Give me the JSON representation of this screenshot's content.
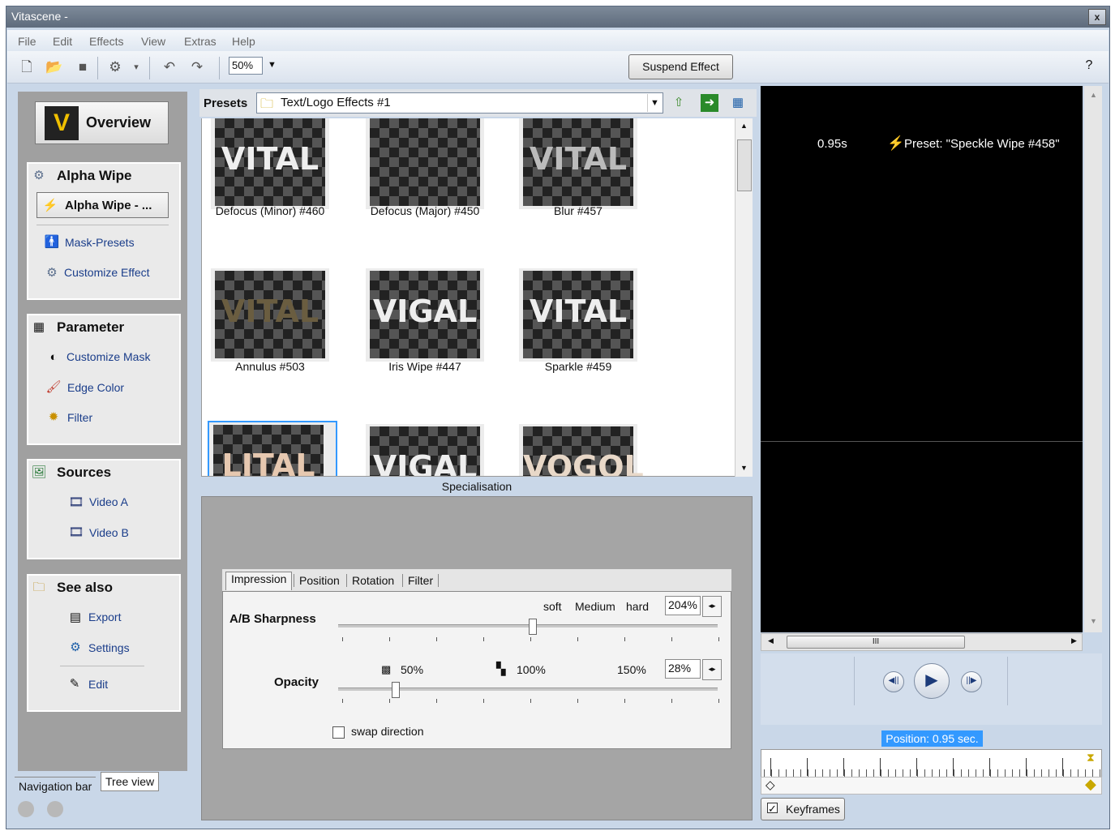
{
  "window": {
    "title": "Vitascene -",
    "close_label": "x"
  },
  "menu": [
    "File",
    "Edit",
    "Effects",
    "View",
    "Extras",
    "Help"
  ],
  "toolbar": {
    "zoom_value": "50%",
    "suspend_label": "Suspend Effect"
  },
  "nav": {
    "overview_label": "Overview",
    "overview_logo": "V",
    "alpha_section": "Alpha Wipe",
    "alpha_current": "Alpha Wipe - ...",
    "mask_presets": "Mask-Presets",
    "customize_effect": "Customize Effect",
    "parameter_section": "Parameter",
    "customize_mask": "Customize Mask",
    "edge_color": "Edge Color",
    "filter": "Filter",
    "sources_section": "Sources",
    "video_a": "Video A",
    "video_b": "Video B",
    "see_also_section": "See also",
    "export": "Export",
    "settings": "Settings",
    "edit": "Edit",
    "tab_navigation": "Navigation bar",
    "tab_tree": "Tree view"
  },
  "presets": {
    "label": "Presets",
    "combo_value": "Text/Logo Effects #1",
    "items": [
      {
        "name": "Defocus (Minor) #460",
        "thumb_text": "VITAL"
      },
      {
        "name": "Defocus (Major) #450",
        "thumb_text": ""
      },
      {
        "name": "Blur #457",
        "thumb_text": "VITAL"
      },
      {
        "name": "Annulus #503",
        "thumb_text": "VITAL"
      },
      {
        "name": "Iris Wipe #447",
        "thumb_text": "VIGAL"
      },
      {
        "name": "Sparkle #459",
        "thumb_text": "VITAL"
      },
      {
        "name": "",
        "thumb_text": "LITAL"
      },
      {
        "name": "",
        "thumb_text": "VIGAL"
      },
      {
        "name": "",
        "thumb_text": "VOGOL"
      }
    ]
  },
  "specialisation": {
    "title": "Specialisation",
    "tabs": [
      "Impression",
      "Position",
      "Rotation",
      "Filter"
    ],
    "sharpness_label": "A/B Sharpness",
    "soft": "soft",
    "medium": "Medium",
    "hard": "hard",
    "sharpness_value": "204%",
    "sharpness_level": 0.51,
    "opacity_label": "Opacity",
    "op_50": "50%",
    "op_100": "100%",
    "op_150": "150%",
    "opacity_value": "28%",
    "opacity_level": 0.15,
    "swap_label": "swap direction"
  },
  "preview": {
    "time": "0.95s",
    "preset_text": "Preset: \"Speckle Wipe #458\"",
    "position": "Position: 0.95 sec.",
    "keyframes_label": "Keyframes",
    "hthumb_grip": "III"
  },
  "colors": {
    "accent": "#3399ff",
    "lightning": "#f5c400"
  }
}
